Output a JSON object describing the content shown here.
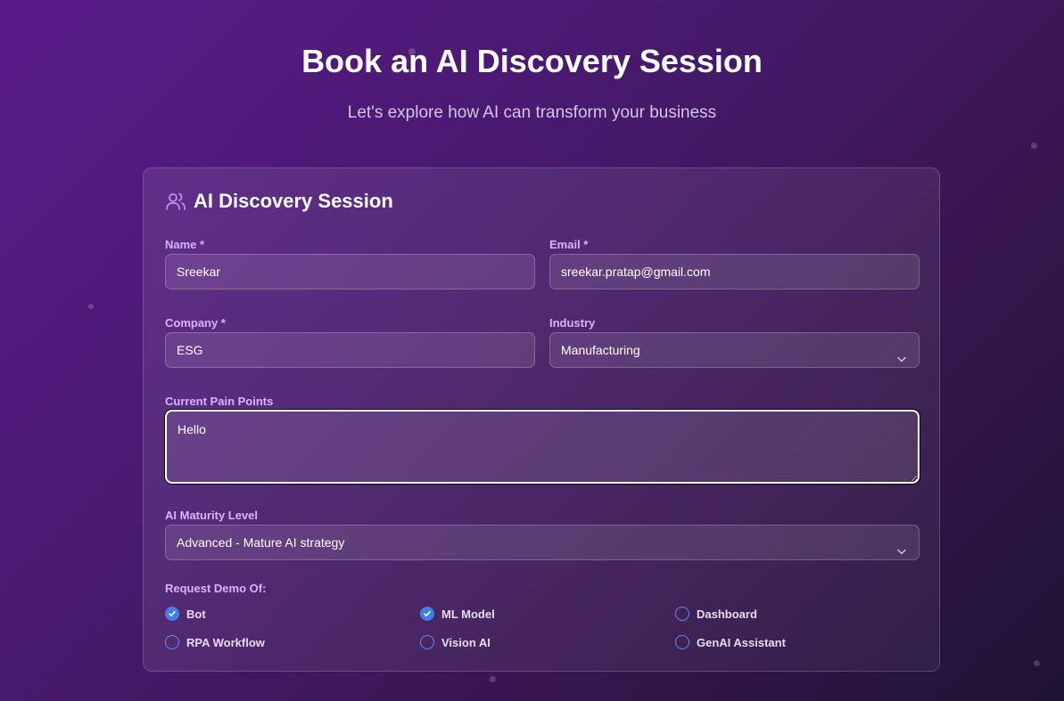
{
  "page": {
    "title": "Book an AI Discovery Session",
    "subtitle": "Let's explore how AI can transform your business"
  },
  "card": {
    "icon": "users-icon",
    "title": "AI Discovery Session"
  },
  "form": {
    "name": {
      "label": "Name *",
      "value": "Sreekar"
    },
    "email": {
      "label": "Email *",
      "value": "sreekar.pratap@gmail.com"
    },
    "company": {
      "label": "Company *",
      "value": "ESG"
    },
    "industry": {
      "label": "Industry",
      "value": "Manufacturing"
    },
    "pain_points": {
      "label": "Current Pain Points",
      "value": "Hello"
    },
    "maturity": {
      "label": "AI Maturity Level",
      "value": "Advanced - Mature AI strategy"
    },
    "demo": {
      "label": "Request Demo Of:",
      "options": [
        {
          "label": "Bot",
          "checked": true
        },
        {
          "label": "ML Model",
          "checked": true
        },
        {
          "label": "Dashboard",
          "checked": false
        },
        {
          "label": "RPA Workflow",
          "checked": false
        },
        {
          "label": "Vision AI",
          "checked": false
        },
        {
          "label": "GenAI Assistant",
          "checked": false
        }
      ]
    }
  },
  "colors": {
    "accent": "#d9b3ff",
    "checkbox": "#3f7fe6"
  }
}
